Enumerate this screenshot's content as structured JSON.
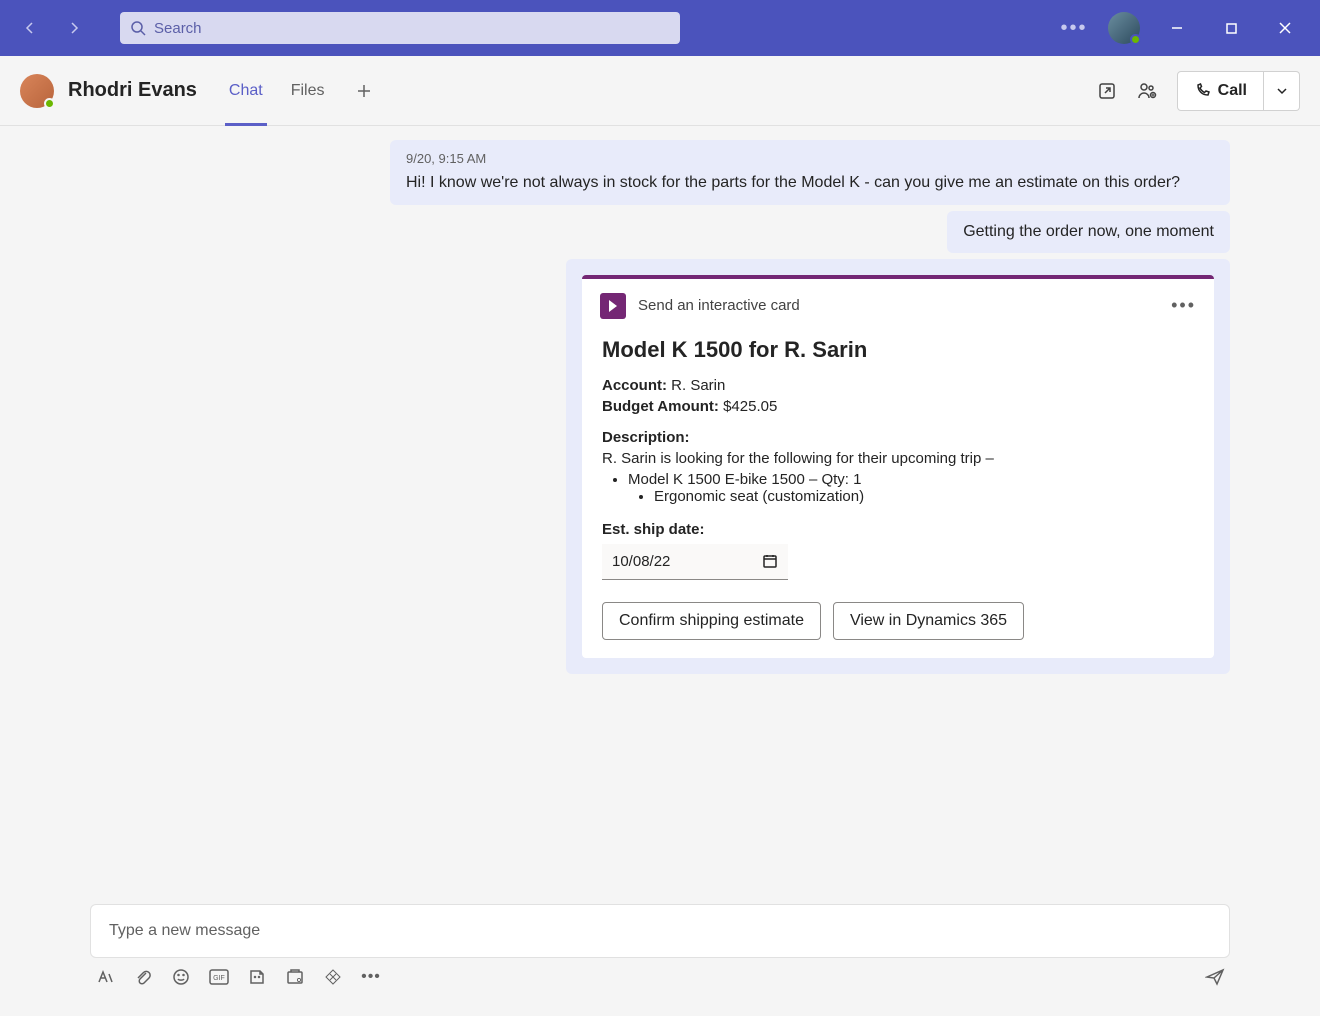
{
  "titlebar": {
    "search_placeholder": "Search"
  },
  "header": {
    "contact_name": "Rhodri Evans",
    "tabs": {
      "chat": "Chat",
      "files": "Files"
    },
    "call_label": "Call"
  },
  "messages": {
    "m1": {
      "timestamp": "9/20, 9:15 AM",
      "text": "Hi! I know we're not always in stock for the parts for the Model K - can you give me an estimate on this order?"
    },
    "m2": {
      "text": "Getting the order now, one moment"
    }
  },
  "card": {
    "app_label": "Send an interactive card",
    "title": "Model K 1500 for R. Sarin",
    "account_label": "Account:",
    "account_value": " R. Sarin",
    "budget_label": "Budget Amount:",
    "budget_value": " $425.05",
    "description_label": "Description:",
    "description_text": "R. Sarin is looking for the following for their upcoming trip –",
    "item1": "Model K 1500 E-bike 1500 – Qty: 1",
    "item1_sub": "Ergonomic seat (customization)",
    "ship_label": "Est. ship date:",
    "ship_value": "10/08/22",
    "btn_confirm": "Confirm shipping estimate",
    "btn_view": "View in Dynamics 365"
  },
  "compose": {
    "placeholder": "Type a new message"
  }
}
